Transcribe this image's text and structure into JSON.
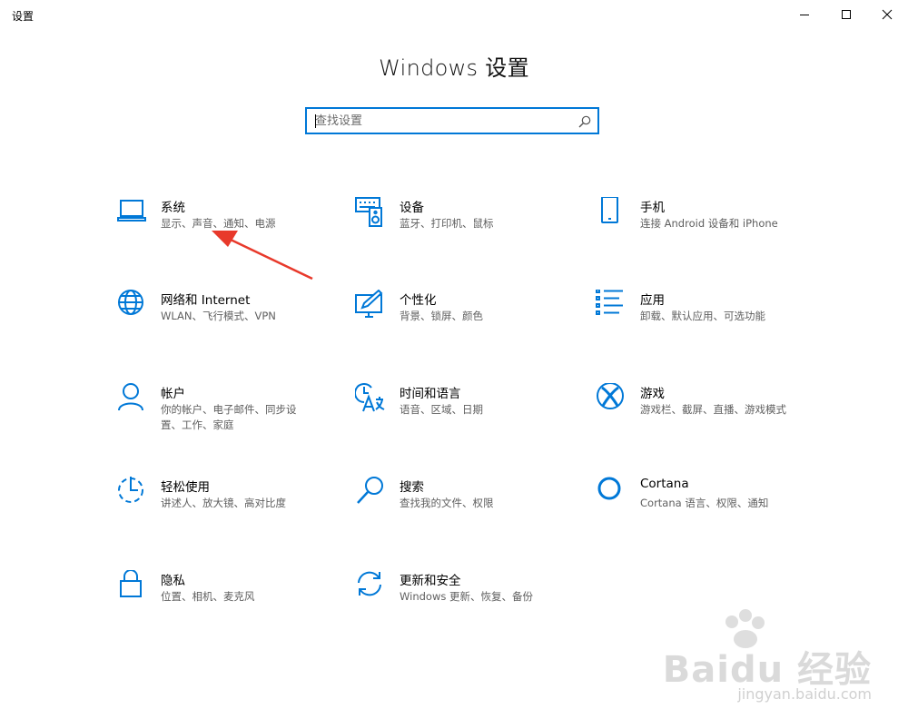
{
  "window": {
    "title": "设置",
    "controls": [
      "minimize-icon",
      "maximize-icon",
      "close-icon"
    ]
  },
  "heading": "Windows 设置",
  "search": {
    "placeholder": "查找设置",
    "icon": "search-icon"
  },
  "accent_color": "#0078d7",
  "tiles": [
    {
      "name": "系统",
      "desc": "显示、声音、通知、电源",
      "icon": "laptop-icon"
    },
    {
      "name": "设备",
      "desc": "蓝牙、打印机、鼠标",
      "icon": "keyboard-speaker-icon"
    },
    {
      "name": "手机",
      "desc": "连接 Android 设备和 iPhone",
      "icon": "phone-icon"
    },
    {
      "name": "网络和 Internet",
      "desc": "WLAN、飞行模式、VPN",
      "icon": "globe-icon"
    },
    {
      "name": "个性化",
      "desc": "背景、锁屏、颜色",
      "icon": "monitor-pen-icon"
    },
    {
      "name": "应用",
      "desc": "卸载、默认应用、可选功能",
      "icon": "list-icon"
    },
    {
      "name": "帐户",
      "desc": "你的帐户、电子邮件、同步设置、工作、家庭",
      "icon": "person-icon"
    },
    {
      "name": "时间和语言",
      "desc": "语音、区域、日期",
      "icon": "clock-language-icon"
    },
    {
      "name": "游戏",
      "desc": "游戏栏、截屏、直播、游戏模式",
      "icon": "xbox-icon"
    },
    {
      "name": "轻松使用",
      "desc": "讲述人、放大镜、高对比度",
      "icon": "ease-of-access-icon"
    },
    {
      "name": "搜索",
      "desc": "查找我的文件、权限",
      "icon": "magnifier-icon"
    },
    {
      "name": "Cortana",
      "desc": "Cortana 语言、权限、通知",
      "icon": "cortana-circle-icon"
    },
    {
      "name": "隐私",
      "desc": "位置、相机、麦克风",
      "icon": "lock-icon"
    },
    {
      "name": "更新和安全",
      "desc": "Windows 更新、恢复、备份",
      "icon": "refresh-icon"
    }
  ],
  "annotation": {
    "color": "#e8392b",
    "target": "系统"
  },
  "watermark": {
    "brand": "Baidu 经验",
    "url": "jingyan.baidu.com"
  }
}
